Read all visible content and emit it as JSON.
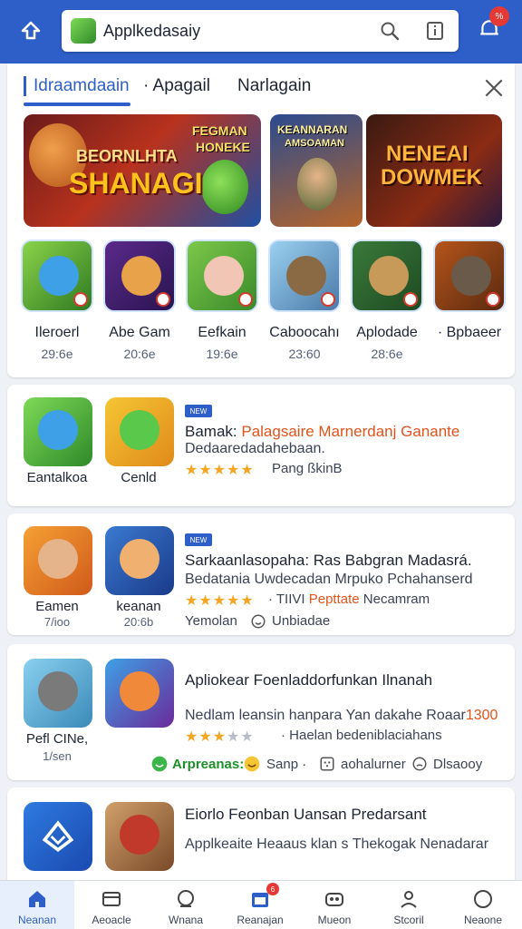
{
  "header": {
    "search_text": "Applkedasaiy",
    "notification_badge": "%",
    "icons": [
      "back-icon",
      "search-icon",
      "info-icon",
      "notification-icon"
    ]
  },
  "tabs": [
    {
      "label": "Idraamdaain",
      "active": true
    },
    {
      "label": "· Apagail",
      "active": false
    },
    {
      "label": "Narlagain",
      "active": false
    }
  ],
  "banners": [
    {
      "line1": "BEORNLHTA",
      "line2": "SHANAGI",
      "line3": "FEGMAN",
      "line4": "HONEKE"
    },
    {
      "line1": "KEANNARAN",
      "line2": "AMSOAMAN"
    },
    {
      "line1": "NENEAI",
      "line2": "DOWMEK"
    }
  ],
  "featured_games": [
    {
      "name": "Ilerоеrl",
      "size": "29:6e"
    },
    {
      "name": "Abe Gam",
      "size": "20:6e"
    },
    {
      "name": "Eefkain",
      "size": "19:6e"
    },
    {
      "name": "Caboocahı",
      "size": "23:60"
    },
    {
      "name": "Aplodade",
      "size": "28:6e"
    },
    {
      "name": "· Bpbaeer",
      "size": ""
    }
  ],
  "list_items": [
    {
      "icons": [
        {
          "label": "Eantalkoa",
          "sub": ""
        },
        {
          "label": "Cenld",
          "sub": ""
        }
      ],
      "tag": "NEW",
      "title_prefix": "Bamak: ",
      "title_highlight": "Palagsaire Marnerdanj Ganante",
      "desc": "Dedaaredadahebaan.",
      "stars": 4.5,
      "stars_text": "★★★★★",
      "meta": "Pang ßkinB"
    },
    {
      "icons": [
        {
          "label": "Eamen",
          "sub": "7/ioo"
        },
        {
          "label": "keanan",
          "sub": "20:6b"
        }
      ],
      "tag": "NEW",
      "title": "Sarkaanlasopaha: Ras Babgran Madasrá.",
      "desc": "Bedatania Uwdecadan Mrpuko Pchahanserd",
      "stars_text": "★★★★★",
      "meta_prefix": "· TIIVI ",
      "meta_highlight": "Pepttate",
      "meta_suffix": " Necamram",
      "meta2_a": "Yemolan",
      "meta2_b": "Unbiadae"
    },
    {
      "icons": [
        {
          "label": "Pefl CINe,",
          "sub": "1/sen"
        },
        {
          "label": "",
          "sub": ""
        }
      ],
      "title": "Apliokear Foenladdorfunkan Ilnanah",
      "desc_prefix": "Nedlam leansin hanpara Yan dakahe Roaar",
      "desc_highlight": "1300",
      "stars_text_full": "★★★",
      "stars_text_dim": "★★",
      "meta": "· Haelan bedeniblaciahans",
      "chips": [
        {
          "text": "Arpreanas:",
          "kind": "green"
        },
        {
          "text": "Sanp ·",
          "kind": "normal"
        },
        {
          "text": "aohalurner",
          "kind": "normal"
        },
        {
          "text": "Dlsaooy",
          "kind": "normal"
        }
      ]
    },
    {
      "icons": [
        {
          "label": "",
          "sub": ""
        },
        {
          "label": "",
          "sub": ""
        }
      ],
      "title": "Eiorlo Feonban Uansan Predarsant",
      "desc": "Applkeaite Heaaus klan s Thekogak Nenadarar"
    }
  ],
  "bottom_nav": [
    {
      "label": "Neanan",
      "icon": "home-icon",
      "active": true
    },
    {
      "label": "Aeoacle",
      "icon": "card-icon",
      "active": false
    },
    {
      "label": "Wnana",
      "icon": "chat-icon",
      "active": false
    },
    {
      "label": "Reanajan",
      "icon": "calendar-icon",
      "active": false,
      "badge": "6"
    },
    {
      "label": "Mueon",
      "icon": "game-icon",
      "active": false
    },
    {
      "label": "Stcoril",
      "icon": "person-icon",
      "active": false
    },
    {
      "label": "Neaone",
      "icon": "circle-icon",
      "active": false
    }
  ],
  "colors": {
    "brand_blue": "#2e5fc8",
    "highlight_orange": "#e0541c",
    "star_gold": "#f5a623",
    "badge_red": "#e53935"
  }
}
